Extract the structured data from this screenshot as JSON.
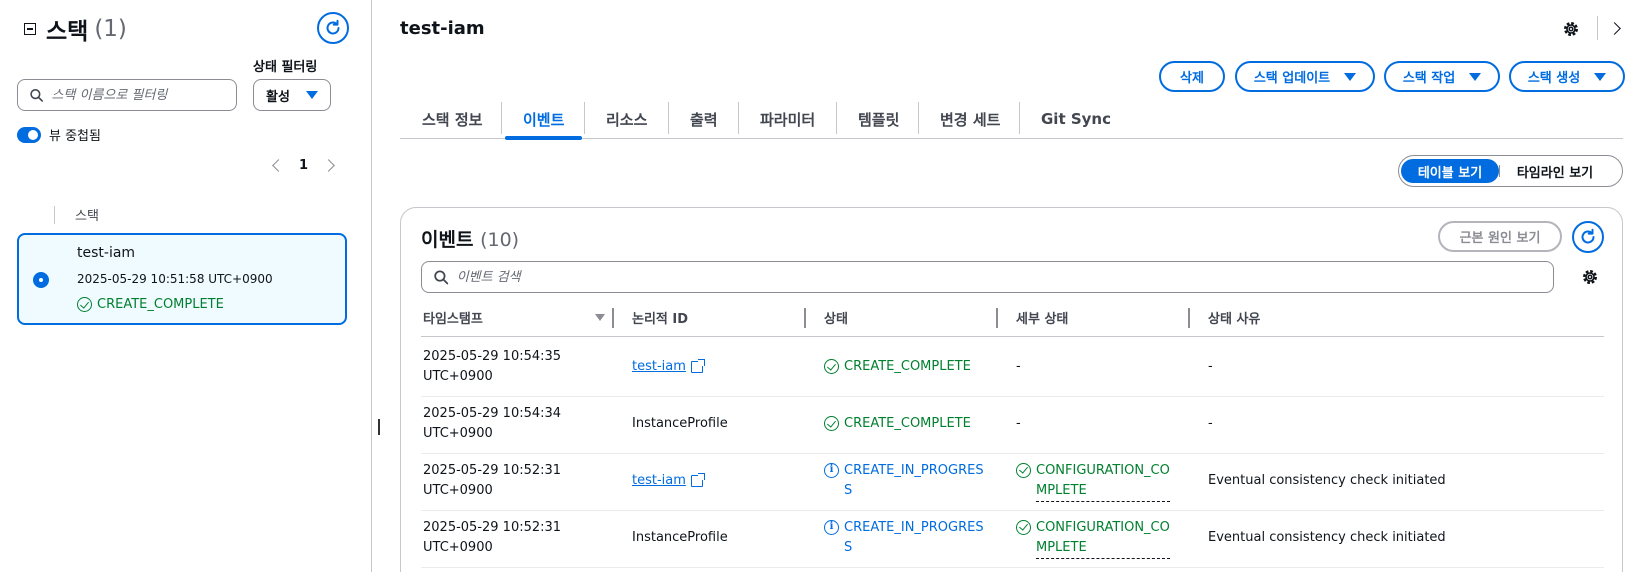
{
  "left_panel": {
    "title": "스택",
    "count": "(1)",
    "filter_placeholder": "스택 이름으로 필터링",
    "status_filter_label": "상태 필터링",
    "status_filter_value": "활성",
    "nested_toggle_label": "뷰 중첩됨",
    "page_number": "1",
    "column_header": "스택",
    "stack": {
      "name": "test-iam",
      "timestamp": "2025-05-29 10:51:58 UTC+0900",
      "status": "CREATE_COMPLETE"
    }
  },
  "header": {
    "title": "test-iam",
    "buttons": {
      "delete": "삭제",
      "update": "스택 업데이트",
      "actions": "스택 작업",
      "create": "스택 생성"
    }
  },
  "tabs": [
    "스택 정보",
    "이벤트",
    "리소스",
    "출력",
    "파라미터",
    "템플릿",
    "변경 세트",
    "Git Sync"
  ],
  "view_toggle": {
    "table": "테이블 보기",
    "timeline": "타임라인 보기"
  },
  "events": {
    "title": "이벤트",
    "count": "(10)",
    "root_cause_button": "근본 원인 보기",
    "search_placeholder": "이벤트 검색",
    "columns": [
      "타임스탬프",
      "논리적 ID",
      "상태",
      "세부 상태",
      "상태 사유"
    ],
    "rows": [
      {
        "ts1": "2025-05-29 10:54:35",
        "ts2": "UTC+0900",
        "logical_id": "test-iam",
        "logical_link": true,
        "status1": "CREATE_COMPLETE",
        "status2": "",
        "status_kind": "ok",
        "detail1": "-",
        "detail2": "",
        "detail_kind": "none",
        "reason": "-"
      },
      {
        "ts1": "2025-05-29 10:54:34",
        "ts2": "UTC+0900",
        "logical_id": "InstanceProfile",
        "logical_link": false,
        "status1": "CREATE_COMPLETE",
        "status2": "",
        "status_kind": "ok",
        "detail1": "-",
        "detail2": "",
        "detail_kind": "none",
        "reason": "-"
      },
      {
        "ts1": "2025-05-29 10:52:31",
        "ts2": "UTC+0900",
        "logical_id": "test-iam",
        "logical_link": true,
        "status1": "CREATE_IN_PROGRES",
        "status2": "S",
        "status_kind": "info",
        "detail1": "CONFIGURATION_CO",
        "detail2": "MPLETE",
        "detail_kind": "ok",
        "reason": "Eventual consistency check initiated"
      },
      {
        "ts1": "2025-05-29 10:52:31",
        "ts2": "UTC+0900",
        "logical_id": "InstanceProfile",
        "logical_link": false,
        "status1": "CREATE_IN_PROGRES",
        "status2": "S",
        "status_kind": "info",
        "detail1": "CONFIGURATION_CO",
        "detail2": "MPLETE",
        "detail_kind": "ok",
        "reason": "Eventual consistency check initiated"
      }
    ]
  },
  "colors": {
    "accent": "#006ce0",
    "success": "#00802f",
    "text": "#0f141a",
    "border": "#c6c6cd"
  }
}
